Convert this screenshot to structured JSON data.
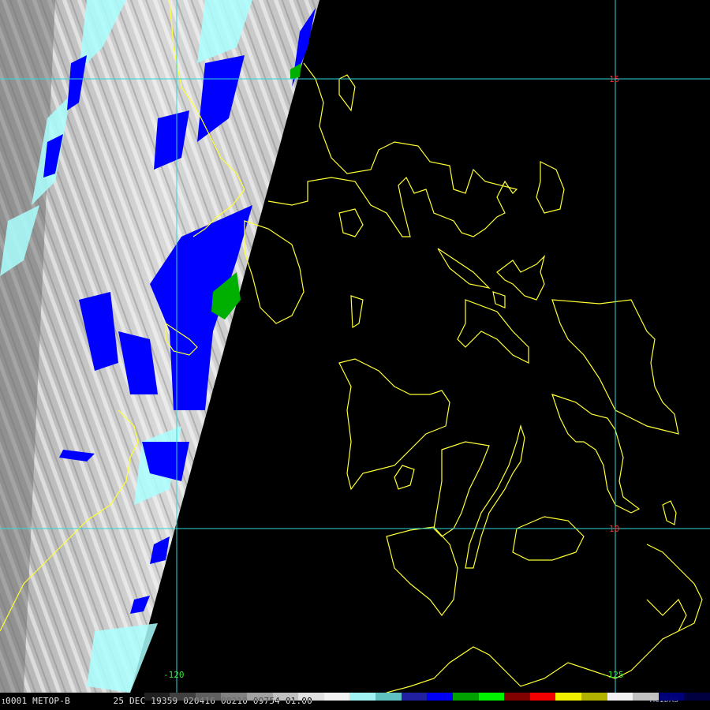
{
  "image": {
    "footer": {
      "id": "1",
      "sat_label": "0001 METOP-B",
      "info": "25 DEC 19359 020416 08210 09754 01.00",
      "brand": "McIDAS"
    },
    "grid": {
      "lat_labels": [
        "15",
        "10"
      ],
      "lon_labels": [
        "-120",
        "-125"
      ]
    },
    "colors": {
      "grid_line": "#33d6d6",
      "coastline": "#ffff33",
      "lat_label": "#ff3030",
      "lon_label": "#33e633",
      "scan_fill": "#9a9a9a",
      "cold_cloud": "#0000ff",
      "very_cold": "#00b000",
      "cyan_edge": "#aaffff"
    },
    "colorbar": [
      "#000000",
      "#222222",
      "#444444",
      "#666666",
      "#888888",
      "#aaaaaa",
      "#cccccc",
      "#eeeeee",
      "#ffffff",
      "#aaffff",
      "#66cccc",
      "#2222aa",
      "#0000ff",
      "#00aa00",
      "#00ff00",
      "#880000",
      "#ff0000",
      "#ffff00",
      "#bbbb00",
      "#ffffff",
      "#cccccc",
      "#000080",
      "#000044"
    ]
  }
}
